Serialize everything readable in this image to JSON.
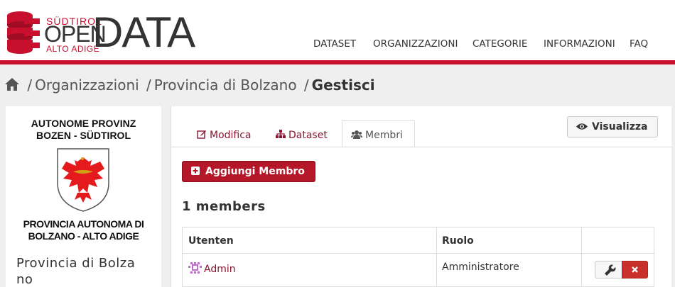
{
  "logo": {
    "top_text": "SÜDTIROL",
    "open_text": "OPEN",
    "bottom_text": "ALTO ADIGE",
    "data_text": "DATA",
    "brand_color": "#c8102e"
  },
  "nav": {
    "items": [
      {
        "label": "DATASET"
      },
      {
        "label": "ORGANIZZAZIONI"
      },
      {
        "label": "CATEGORIE"
      },
      {
        "label": "INFORMAZIONI"
      },
      {
        "label": "FAQ"
      }
    ]
  },
  "breadcrumb": {
    "home_icon": "home-icon",
    "sep": "/",
    "items": [
      {
        "label": "Organizzazioni"
      },
      {
        "label": "Provincia di Bolzano"
      },
      {
        "label": "Gestisci"
      }
    ]
  },
  "sidebar": {
    "title_top_line1": "AUTONOME PROVINZ",
    "title_top_line2": "BOZEN - SÜDTIROL",
    "title_bottom_line1": "PROVINCIA AUTONOMA DI",
    "title_bottom_line2": "BOLZANO - ALTO ADIGE",
    "org_name": "Provincia di Bolzano"
  },
  "tabs": [
    {
      "label": "Modifica",
      "icon": "edit-icon"
    },
    {
      "label": "Dataset",
      "icon": "sitemap-icon"
    },
    {
      "label": "Membri",
      "icon": "users-icon"
    }
  ],
  "actions": {
    "view_label": "Visualizza",
    "view_icon": "eye-icon",
    "add_member_label": "Aggiungi Membro",
    "add_icon": "plus-square-icon"
  },
  "members": {
    "count_label": "1 members",
    "columns": [
      "Utenten",
      "Ruolo",
      ""
    ],
    "rows": [
      {
        "user": "Admin",
        "role": "Amministratore"
      }
    ]
  },
  "colors": {
    "accent": "#c8102e",
    "button_red": "#b41828",
    "link": "#8a1530"
  }
}
